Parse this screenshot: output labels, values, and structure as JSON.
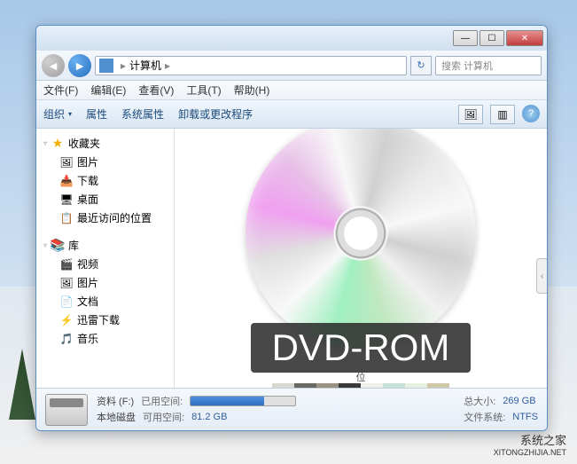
{
  "address": {
    "location": "计算机"
  },
  "search": {
    "placeholder": "搜索 计算机"
  },
  "menu": {
    "file": "文件(F)",
    "edit": "编辑(E)",
    "view": "查看(V)",
    "tools": "工具(T)",
    "help": "帮助(H)"
  },
  "toolbar": {
    "organize": "组织",
    "properties": "属性",
    "systemProperties": "系统属性",
    "uninstall": "卸载或更改程序"
  },
  "sidebar": {
    "favorites": {
      "label": "收藏夹",
      "items": [
        "图片",
        "下载",
        "桌面",
        "最近访问的位置"
      ]
    },
    "libraries": {
      "label": "库",
      "items": [
        "视频",
        "图片",
        "文档",
        "迅雷下载",
        "音乐"
      ]
    }
  },
  "mainView": {
    "dvdLabel": "DVD-ROM",
    "stripLabel": "位",
    "colors": [
      "#d8d8d0",
      "#6a6a62",
      "#9a9282",
      "#3a3a38",
      "#f0f0e8",
      "#c8e0d8",
      "#e8f0e0",
      "#d0c8a8"
    ]
  },
  "status": {
    "driveName": "资料 (F:)",
    "driveType": "本地磁盘",
    "usedLabel": "已用空间:",
    "freeLabel": "可用空间:",
    "freeValue": "81.2 GB",
    "totalLabel": "总大小:",
    "totalValue": "269 GB",
    "fsLabel": "文件系统:",
    "fsValue": "NTFS"
  },
  "watermark": {
    "line1": "系统之家",
    "line2": "XITONGZHIJIA.NET"
  }
}
